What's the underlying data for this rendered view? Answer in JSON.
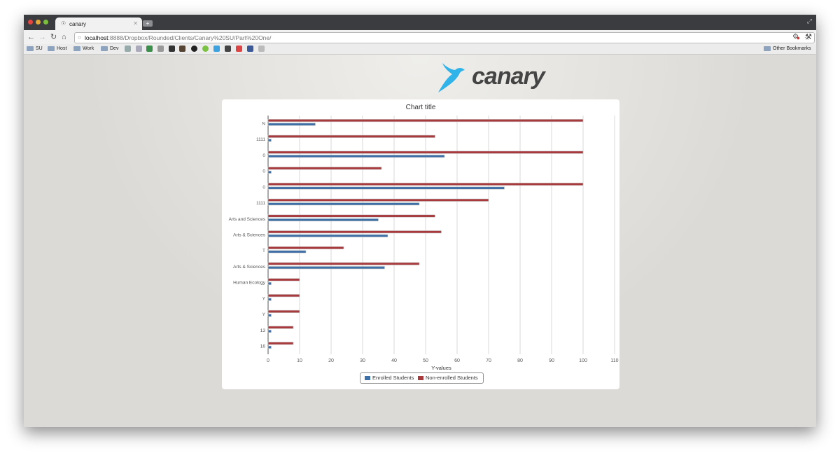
{
  "browser": {
    "tab_title": "canary",
    "url_host": "localhost",
    "url_path": ":8888/Dropbox/Rounded/Clients/Canary%20SU/Part%20One/",
    "bookmarks": [
      "SU",
      "Host",
      "Work",
      "Dev"
    ],
    "other_bookmarks": "Other Bookmarks",
    "icons": {
      "back": "back-arrow-icon",
      "forward": "forward-arrow-icon",
      "reload": "reload-icon",
      "home": "home-icon",
      "star": "star-icon",
      "wrench": "wrench-icon"
    }
  },
  "logo": {
    "text": "canary",
    "color": "#2fb3e8"
  },
  "chart_data": {
    "type": "bar",
    "orientation": "horizontal",
    "title": "Chart title",
    "xlabel": "Y-values",
    "ylabel": "",
    "xlim": [
      0,
      110
    ],
    "xticks": [
      0,
      10,
      20,
      30,
      40,
      50,
      60,
      70,
      80,
      90,
      100,
      110
    ],
    "grid": true,
    "legend_position": "bottom",
    "categories": [
      "N",
      "1111",
      "0",
      "0",
      "0",
      "1111",
      "Arts and Sciences",
      "Arts & Sciences",
      "T",
      "Arts & Sciences",
      "Human Ecology",
      "Y",
      "Y",
      "13",
      "16"
    ],
    "series": [
      {
        "name": "Enrolled Students",
        "color": "#3e6fa6",
        "values": [
          15,
          1,
          56,
          1,
          75,
          48,
          35,
          38,
          12,
          37,
          1,
          1,
          1,
          1,
          1
        ]
      },
      {
        "name": "Non-enrolled Students",
        "color": "#a8393d",
        "values": [
          100,
          53,
          100,
          36,
          100,
          70,
          53,
          55,
          24,
          48,
          10,
          10,
          10,
          8,
          8
        ]
      }
    ]
  }
}
